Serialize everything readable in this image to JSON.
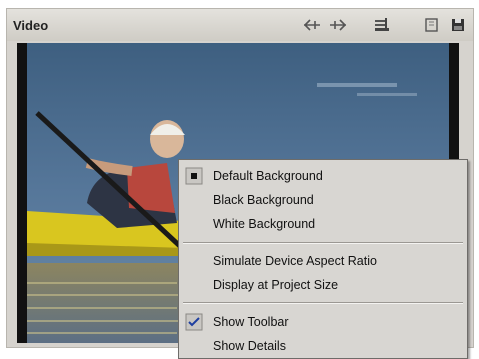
{
  "panel": {
    "title": "Video",
    "toolbar_icons": [
      "shuttle-prev-icon",
      "shuttle-next-icon",
      "layers-icon",
      "snapshot-icon",
      "save-icon"
    ]
  },
  "context_menu": {
    "items": [
      {
        "label": "Default Background",
        "state": "selected-bullet"
      },
      {
        "label": "Black Background",
        "state": "none"
      },
      {
        "label": "White Background",
        "state": "none"
      },
      {
        "label": "Simulate Device Aspect Ratio",
        "state": "none"
      },
      {
        "label": "Display at Project Size",
        "state": "none"
      },
      {
        "label": "Show Toolbar",
        "state": "checked"
      },
      {
        "label": "Show Details",
        "state": "none"
      }
    ]
  },
  "colors": {
    "panel_bg": "#d6d3ce",
    "menu_bg": "#d8d6d2",
    "water": "#4d6d8c",
    "kayak": "#d9c61f"
  }
}
